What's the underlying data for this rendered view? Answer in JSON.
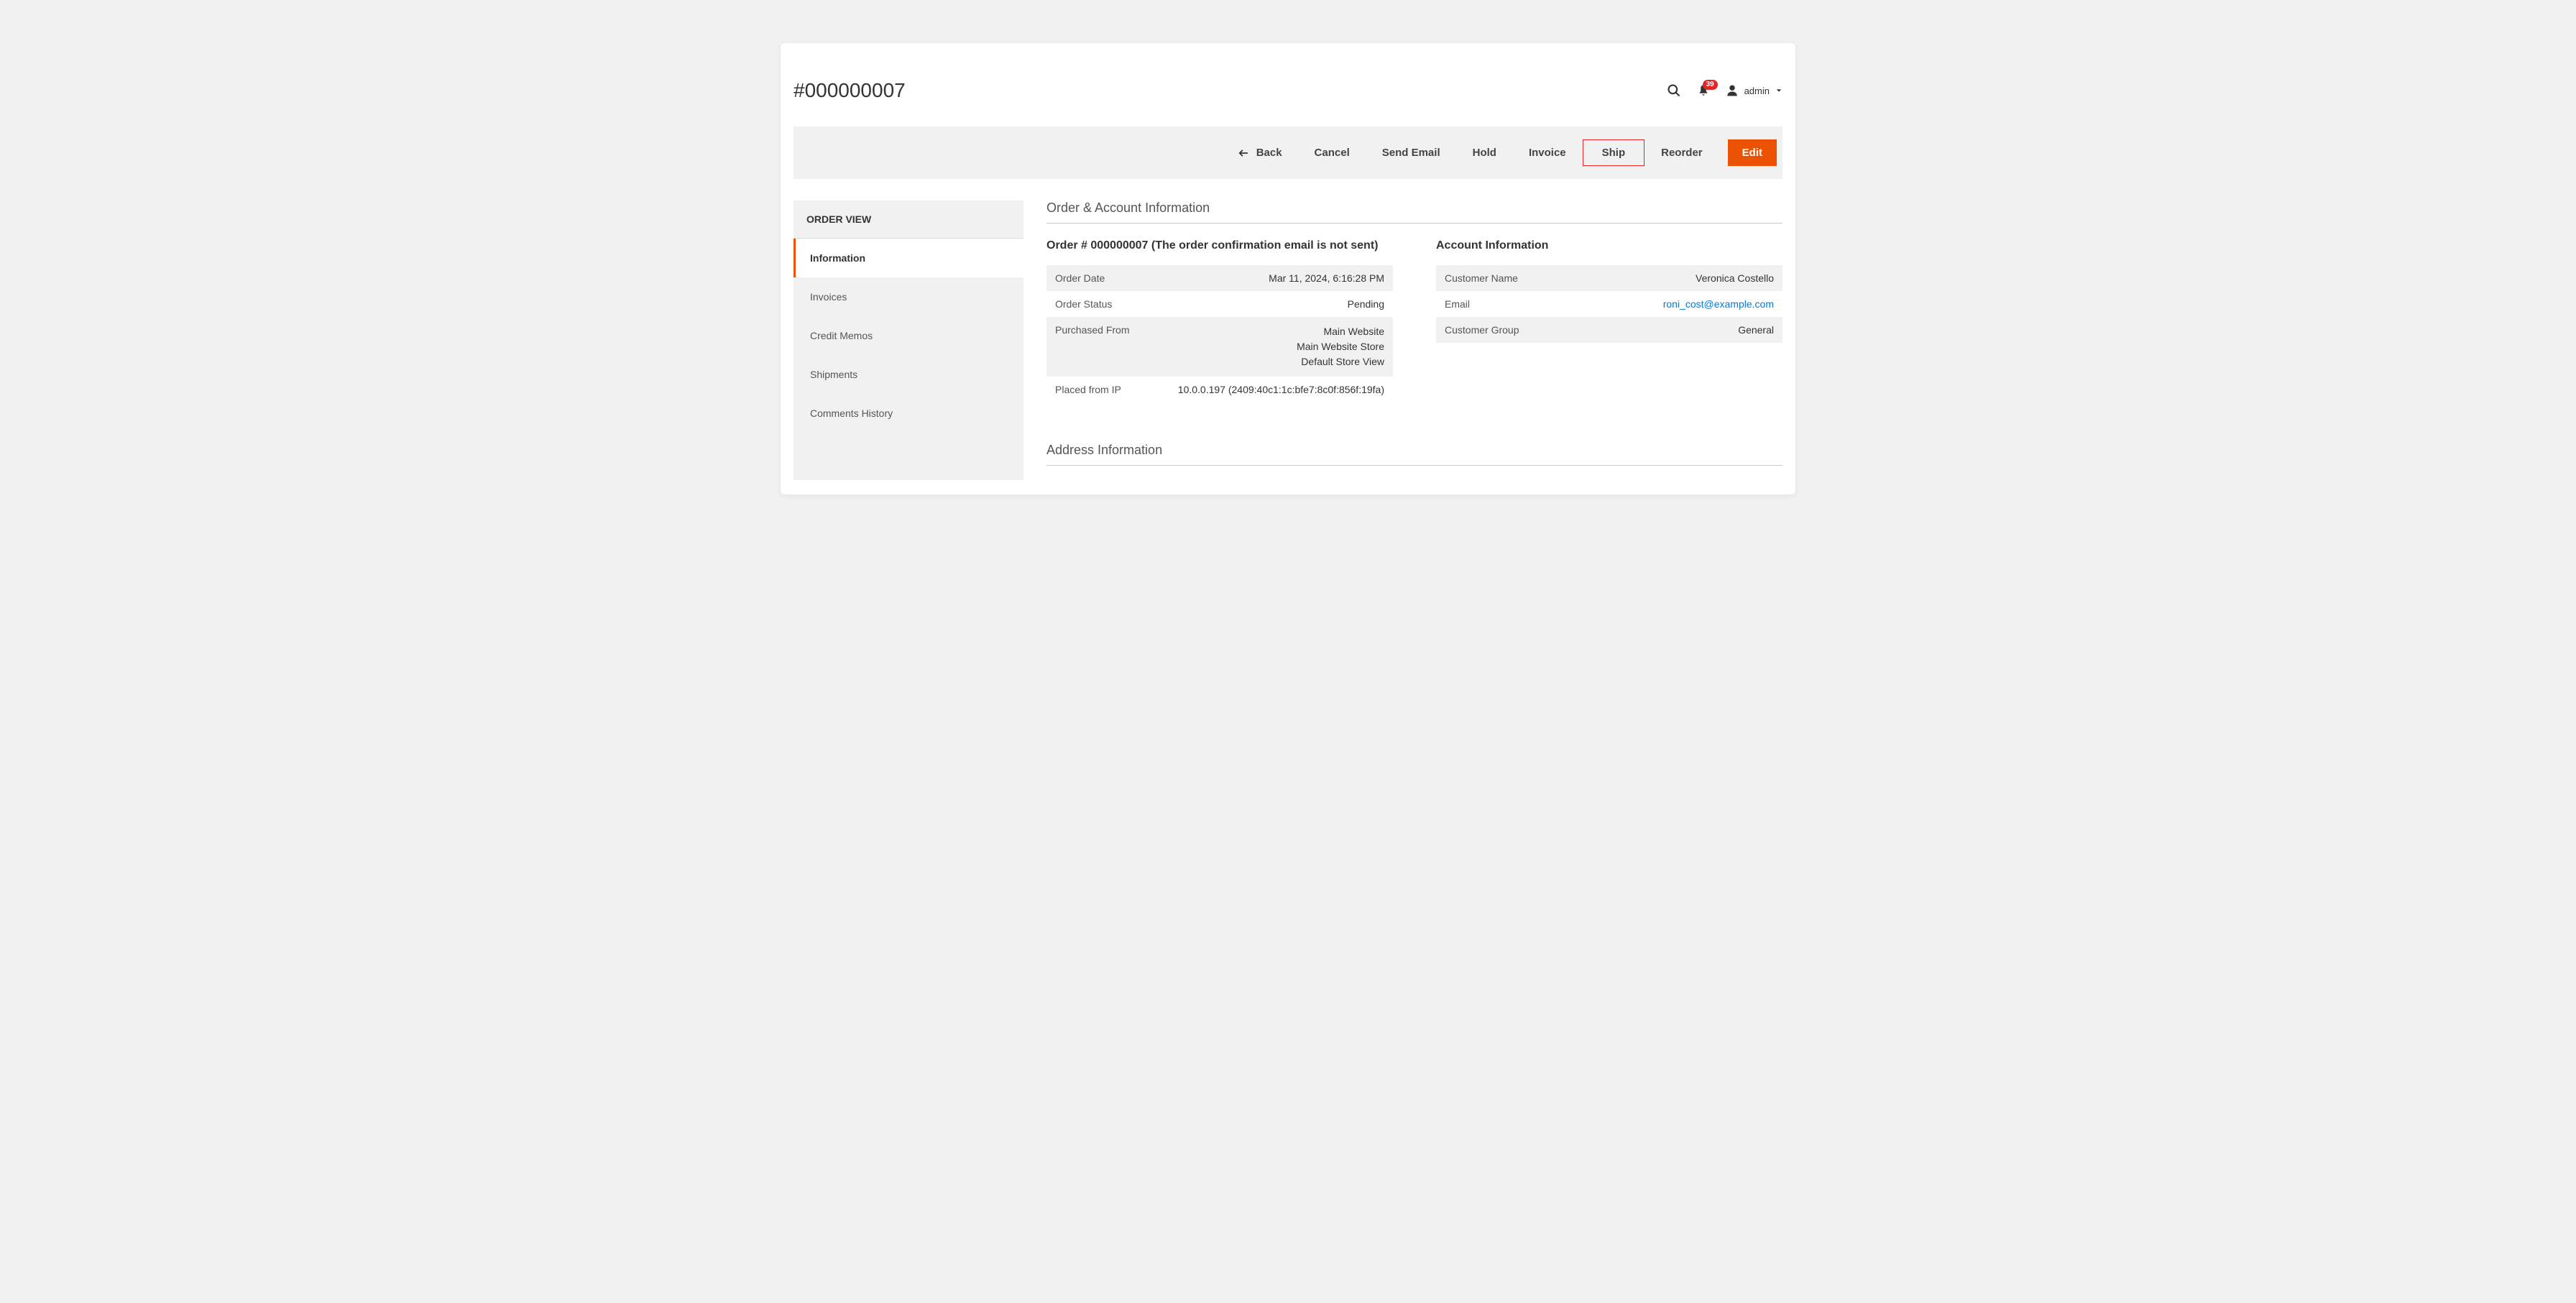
{
  "header": {
    "title": "#000000007",
    "notification_count": "39",
    "admin_label": "admin"
  },
  "actions": {
    "back": "Back",
    "cancel": "Cancel",
    "send_email": "Send Email",
    "hold": "Hold",
    "invoice": "Invoice",
    "ship": "Ship",
    "reorder": "Reorder",
    "edit": "Edit"
  },
  "sidebar": {
    "title": "ORDER VIEW",
    "items": [
      "Information",
      "Invoices",
      "Credit Memos",
      "Shipments",
      "Comments History"
    ]
  },
  "section1_title": "Order & Account Information",
  "order_block": {
    "title": "Order # 000000007 (The order confirmation email is not sent)",
    "rows": {
      "date_label": "Order Date",
      "date_value": "Mar 11, 2024, 6:16:28 PM",
      "status_label": "Order Status",
      "status_value": "Pending",
      "from_label": "Purchased From",
      "from_l1": "Main Website",
      "from_l2": "Main Website Store",
      "from_l3": "Default Store View",
      "ip_label": "Placed from IP",
      "ip_value": "10.0.0.197 (2409:40c1:1c:bfe7:8c0f:856f:19fa)"
    }
  },
  "account_block": {
    "title": "Account Information",
    "name_label": "Customer Name",
    "name_value": "Veronica Costello",
    "email_label": "Email",
    "email_value": "roni_cost@example.com",
    "group_label": "Customer Group",
    "group_value": "General"
  },
  "section2_title": "Address Information"
}
